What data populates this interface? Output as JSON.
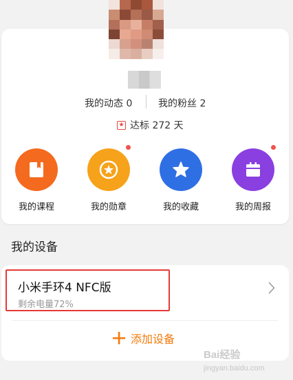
{
  "profile": {
    "stats": {
      "posts_label": "我的动态 0",
      "fans_label": "我的粉丝 2"
    },
    "streak": {
      "icon_glyph": "★",
      "text": "达标 272 天"
    }
  },
  "features": [
    {
      "label": "我的课程",
      "icon": "book-icon",
      "color": "#f46a1e",
      "badge": false
    },
    {
      "label": "我的勋章",
      "icon": "medal-icon",
      "color": "#f6a21a",
      "badge": true
    },
    {
      "label": "我的收藏",
      "icon": "star-icon",
      "color": "#2f6fe4",
      "badge": false
    },
    {
      "label": "我的周报",
      "icon": "calendar-icon",
      "color": "#8a3fe0",
      "badge": true
    }
  ],
  "devices_section": {
    "title": "我的设备",
    "device": {
      "name": "小米手环4 NFC版",
      "battery": "剩余电量72%"
    },
    "add_label": "添加设备"
  },
  "watermark": {
    "brand": "Bai",
    "suffix": "经验",
    "domain": "jingyan.baidu.com"
  },
  "colors": {
    "accent": "#f47a0b",
    "highlight": "#e53935",
    "badge": "#f0534e"
  }
}
